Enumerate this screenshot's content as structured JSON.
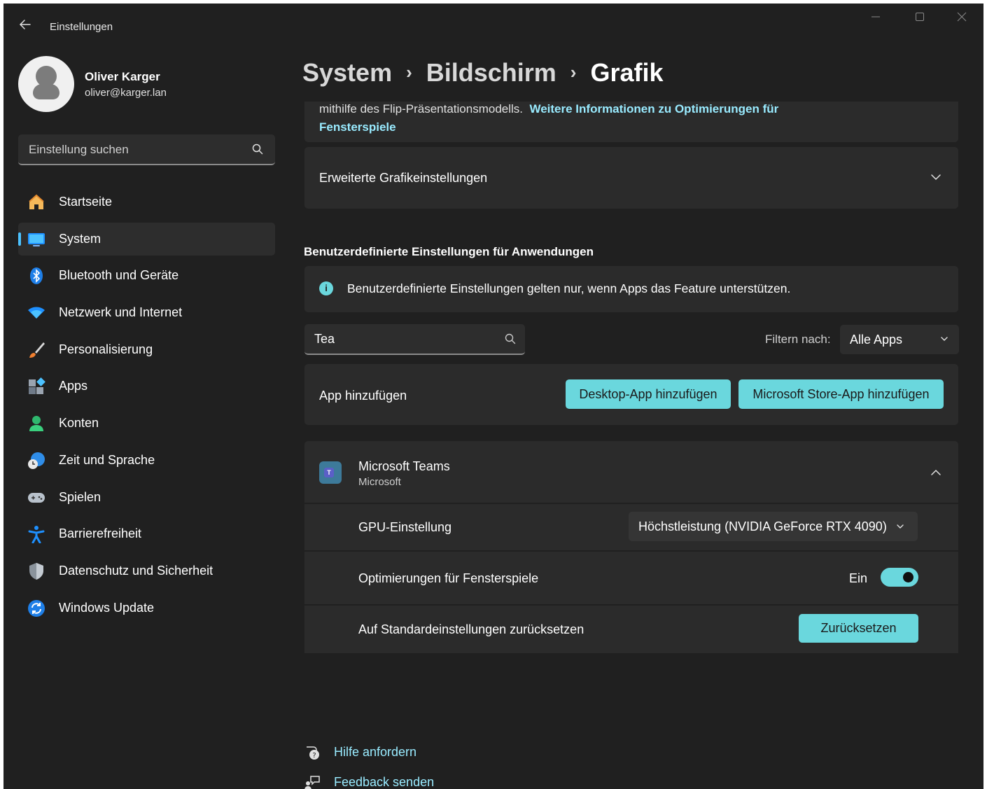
{
  "window": {
    "title": "Einstellungen",
    "controls": [
      "minimize",
      "maximize",
      "close"
    ]
  },
  "profile": {
    "name": "Oliver Karger",
    "email": "oliver@karger.lan"
  },
  "search": {
    "placeholder": "Einstellung suchen"
  },
  "sidebar": {
    "active": "System",
    "items": [
      {
        "label": "Startseite",
        "icon": "home-icon"
      },
      {
        "label": "System",
        "icon": "system-icon"
      },
      {
        "label": "Bluetooth und Geräte",
        "icon": "bluetooth-icon"
      },
      {
        "label": "Netzwerk und Internet",
        "icon": "wifi-icon"
      },
      {
        "label": "Personalisierung",
        "icon": "brush-icon"
      },
      {
        "label": "Apps",
        "icon": "apps-icon"
      },
      {
        "label": "Konten",
        "icon": "account-icon"
      },
      {
        "label": "Zeit und Sprache",
        "icon": "time-language-icon"
      },
      {
        "label": "Spielen",
        "icon": "gaming-icon"
      },
      {
        "label": "Barrierefreiheit",
        "icon": "accessibility-icon"
      },
      {
        "label": "Datenschutz und Sicherheit",
        "icon": "shield-icon"
      },
      {
        "label": "Windows Update",
        "icon": "update-icon"
      }
    ]
  },
  "breadcrumb": {
    "items": [
      "System",
      "Bildschirm",
      "Grafik"
    ],
    "separator": "›"
  },
  "main": {
    "top_card": {
      "text": "mithilfe des Flip-Präsentationsmodells.",
      "link": "Weitere Informationen zu Optimierungen für Fensterspiele"
    },
    "advanced": {
      "label": "Erweiterte Grafikeinstellungen"
    },
    "custom_section": {
      "heading": "Benutzerdefinierte Einstellungen für Anwendungen",
      "info": "Benutzerdefinierte Einstellungen gelten nur, wenn Apps das Feature unterstützen."
    },
    "app_search": {
      "value": "Tea"
    },
    "filter": {
      "label": "Filtern nach:",
      "value": "Alle Apps"
    },
    "add_app": {
      "label": "App hinzufügen",
      "desktop_button": "Desktop-App hinzufügen",
      "store_button": "Microsoft Store-App hinzufügen"
    },
    "app_entry": {
      "name": "Microsoft Teams",
      "publisher": "Microsoft",
      "expanded": true,
      "gpu": {
        "label": "GPU-Einstellung",
        "value": "Höchstleistung (NVIDIA GeForce RTX 4090)"
      },
      "windowed_opt": {
        "label": "Optimierungen für Fensterspiele",
        "state": "Ein",
        "on": true
      },
      "reset": {
        "label": "Auf Standardeinstellungen zurücksetzen",
        "button": "Zurücksetzen"
      }
    },
    "help": {
      "get_help": "Hilfe anfordern",
      "feedback": "Feedback senden"
    }
  },
  "colors": {
    "background": "#202020",
    "card": "#2b2b2b",
    "accent": "#6ad7dd",
    "link": "#99ebff",
    "indicator": "#4cc2ff"
  }
}
